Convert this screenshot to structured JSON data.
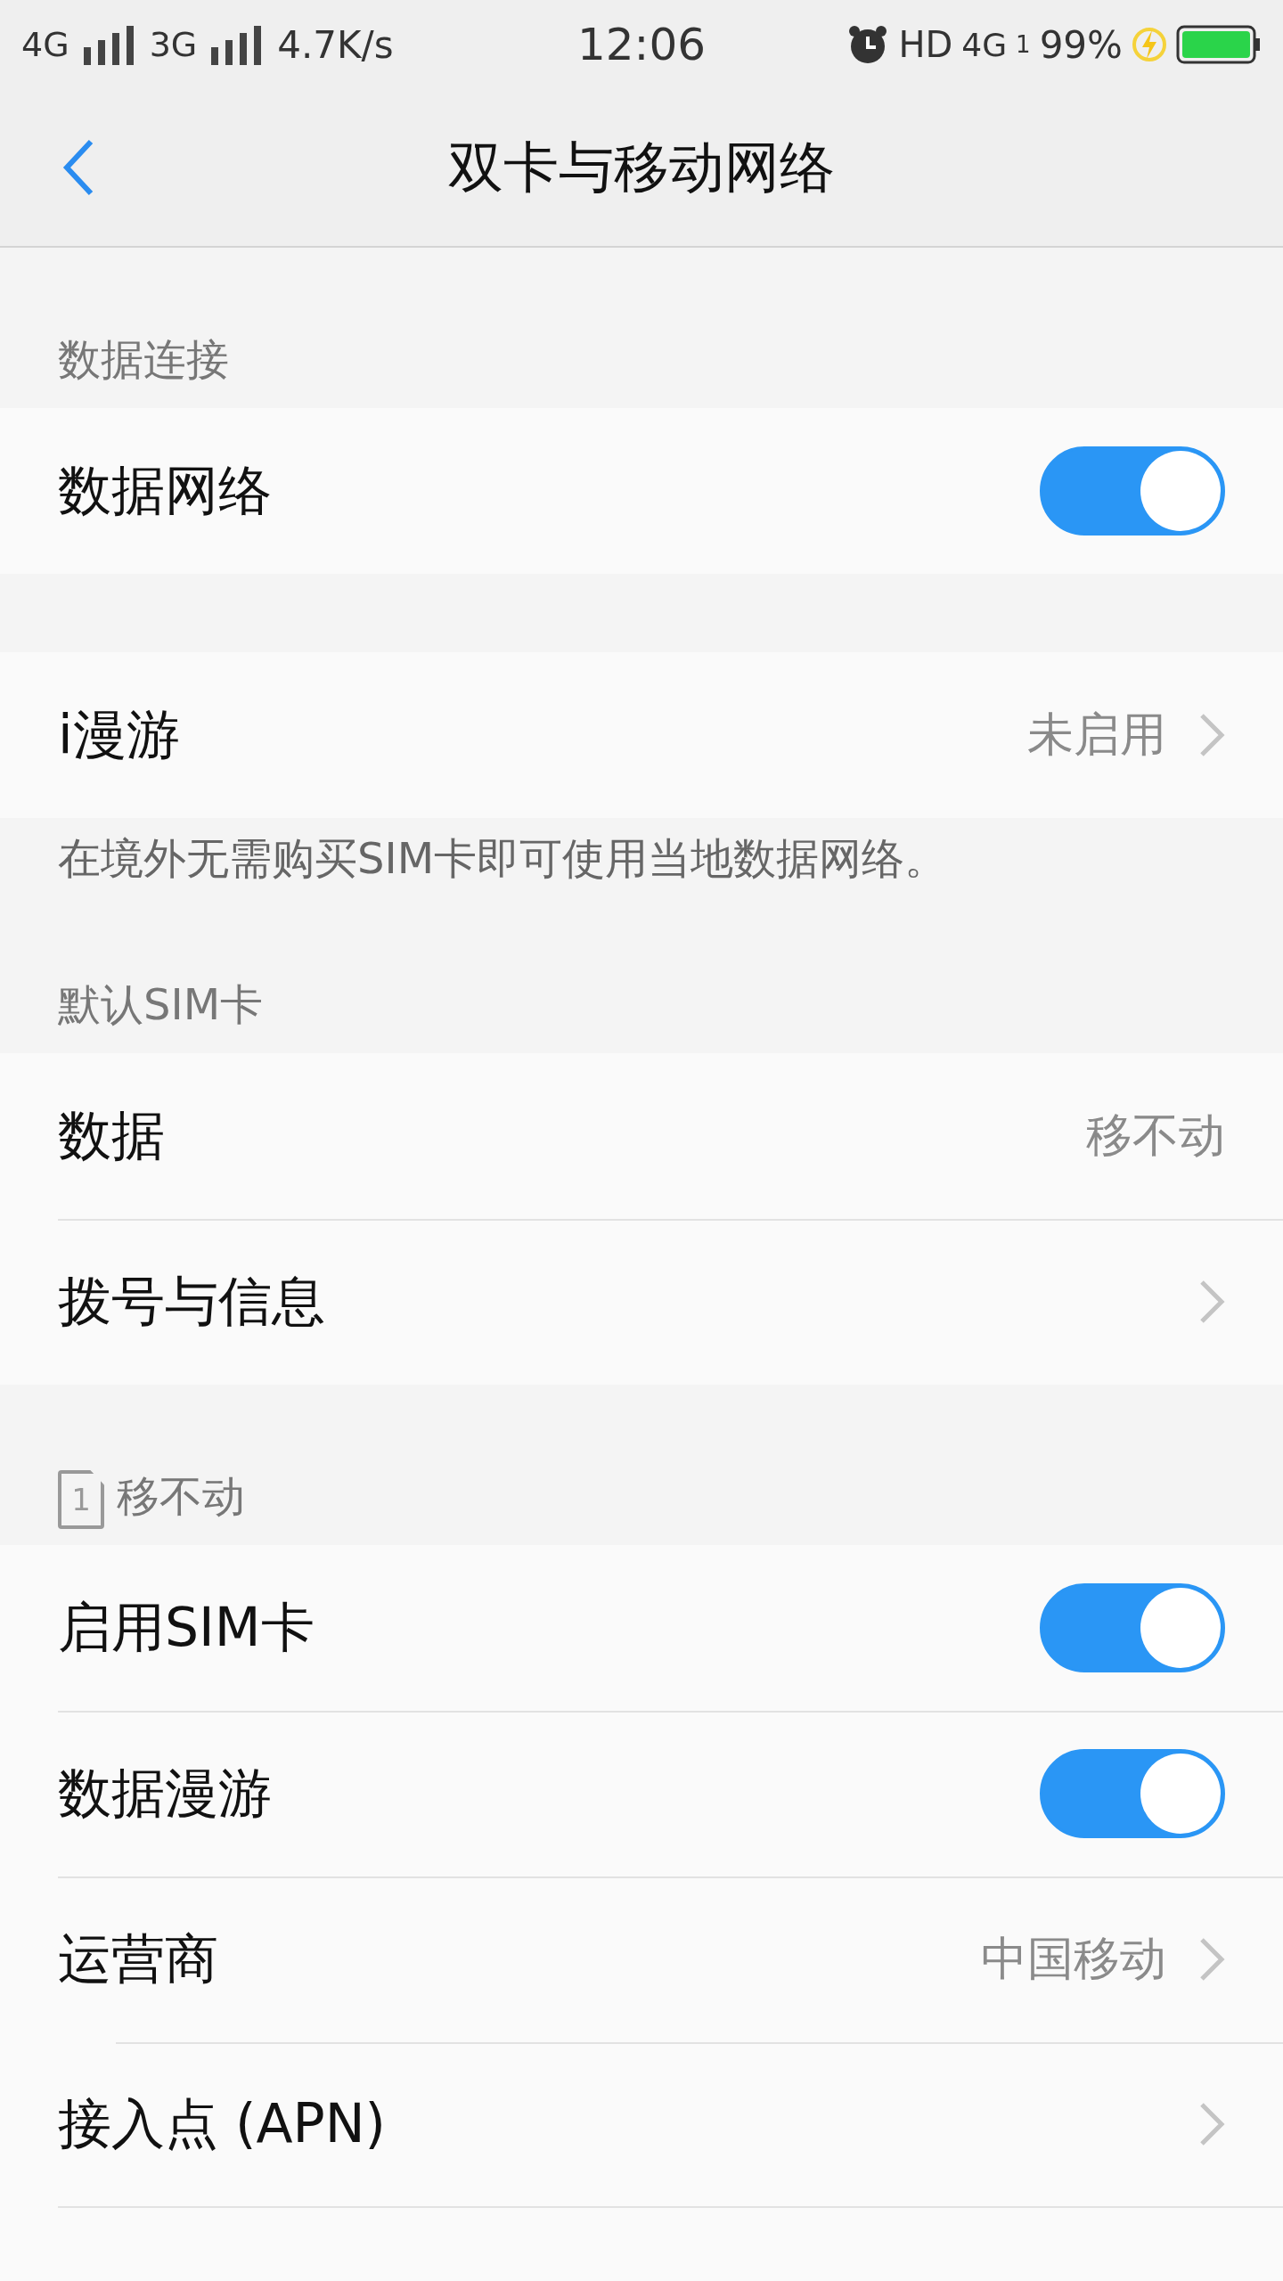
{
  "status_bar": {
    "signals": [
      {
        "label": "4G"
      },
      {
        "label": "3G"
      }
    ],
    "speed": "4.7K/s",
    "time": "12:06",
    "hd": "HD",
    "network": "4G",
    "sim_index": "1",
    "battery": "99%",
    "charging": true
  },
  "header": {
    "title": "双卡与移动网络"
  },
  "sections": [
    {
      "label": "数据连接",
      "rows": [
        {
          "kind": "toggle",
          "label": "数据网络",
          "on": true
        }
      ]
    },
    {
      "rows": [
        {
          "kind": "link",
          "label": "i漫游",
          "value": "未启用"
        }
      ],
      "note": "在境外无需购买SIM卡即可使用当地数据网络。"
    },
    {
      "label": "默认SIM卡",
      "rows": [
        {
          "kind": "value",
          "label": "数据",
          "value": "移不动"
        },
        {
          "kind": "link",
          "label": "拨号与信息"
        }
      ]
    },
    {
      "label": "移不动",
      "sim_badge": "1",
      "rows": [
        {
          "kind": "toggle",
          "label": "启用SIM卡",
          "on": true
        },
        {
          "kind": "toggle",
          "label": "数据漫游",
          "on": true
        },
        {
          "kind": "link",
          "label": "运营商",
          "value": "中国移动"
        },
        {
          "kind": "link",
          "label": "接入点 (APN)"
        }
      ]
    }
  ]
}
